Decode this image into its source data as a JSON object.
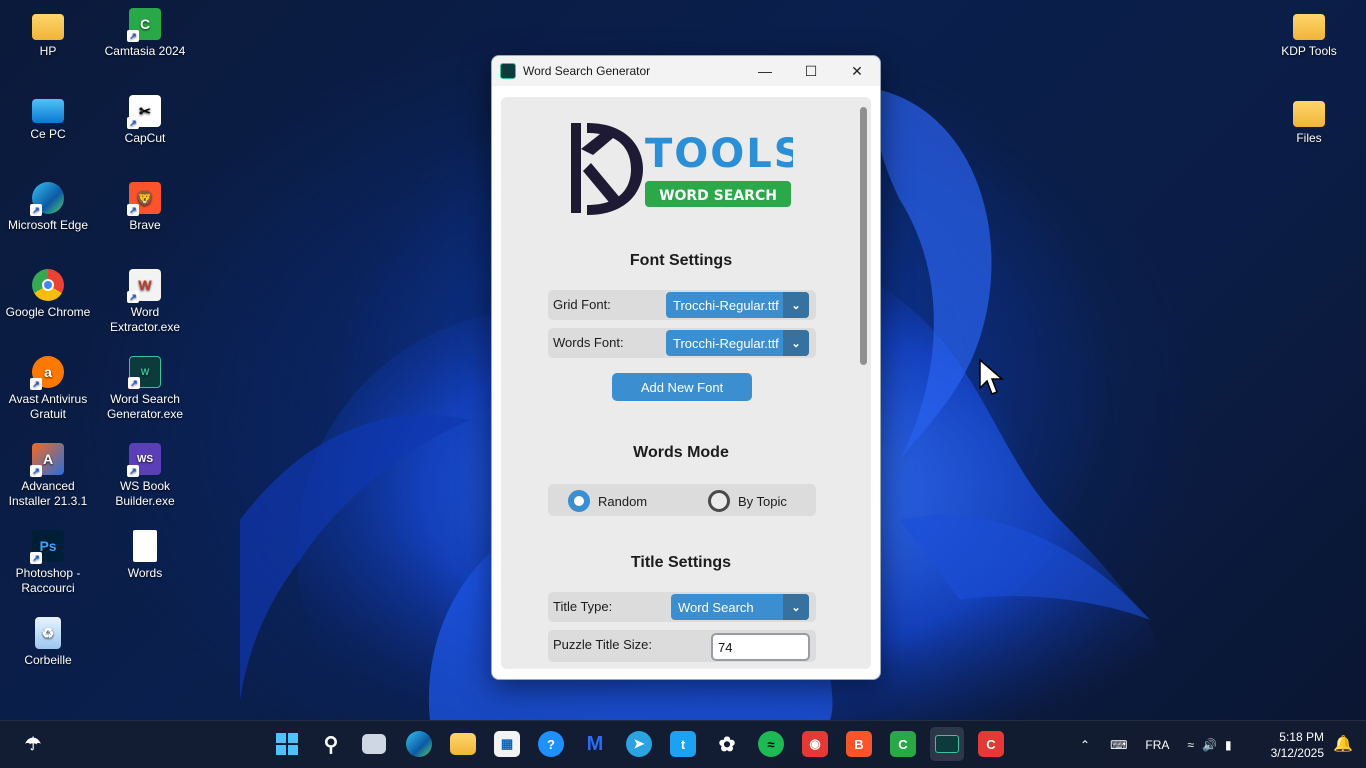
{
  "desktop": {
    "left_icons": [
      {
        "label": "HP",
        "icon": "folder-icon"
      },
      {
        "label": "Camtasia 2024",
        "icon": "camtasia-icon"
      },
      {
        "label": "Ce PC",
        "icon": "computer-icon"
      },
      {
        "label": "CapCut",
        "icon": "capcut-icon"
      },
      {
        "label": "Microsoft Edge",
        "icon": "edge-icon"
      },
      {
        "label": "Brave",
        "icon": "brave-icon"
      },
      {
        "label": "Google Chrome",
        "icon": "chrome-icon"
      },
      {
        "label": "Word Extractor.exe",
        "icon": "word-extractor-icon"
      },
      {
        "label": "Avast Antivirus Gratuit",
        "icon": "avast-icon"
      },
      {
        "label": "Word Search Generator.exe",
        "icon": "word-search-icon"
      },
      {
        "label": "Advanced Installer 21.3.1",
        "icon": "advanced-installer-icon"
      },
      {
        "label": "WS Book Builder.exe",
        "icon": "ws-book-icon"
      },
      {
        "label": "Photoshop - Raccourci",
        "icon": "photoshop-icon"
      },
      {
        "label": "Words",
        "icon": "document-icon"
      },
      {
        "label": "Corbeille",
        "icon": "recycle-bin-icon"
      }
    ],
    "right_icons": [
      {
        "label": "KDP Tools",
        "icon": "folder-icon"
      },
      {
        "label": "Files",
        "icon": "folder-icon"
      }
    ]
  },
  "window": {
    "title": "Word Search Generator",
    "logo": {
      "brand": "TOOLS",
      "letters": "KD",
      "banner": "WORD SEARCH"
    },
    "font_settings": {
      "heading": "Font Settings",
      "grid_font_label": "Grid Font:",
      "grid_font_value": "Trocchi-Regular.ttf",
      "words_font_label": "Words Font:",
      "words_font_value": "Trocchi-Regular.ttf",
      "add_font_label": "Add New Font"
    },
    "words_mode": {
      "heading": "Words Mode",
      "options": [
        "Random",
        "By Topic"
      ],
      "selected": "Random"
    },
    "title_settings": {
      "heading": "Title Settings",
      "title_type_label": "Title Type:",
      "title_type_value": "Word Search",
      "title_size_label": "Puzzle Title Size:",
      "title_size_value": "74"
    }
  },
  "taskbar": {
    "language": "FRA",
    "time": "5:18 PM",
    "date": "3/12/2025"
  },
  "colors": {
    "accent": "#3b8ed0",
    "accent_dark": "#36719f",
    "panel": "#ebebeb"
  }
}
